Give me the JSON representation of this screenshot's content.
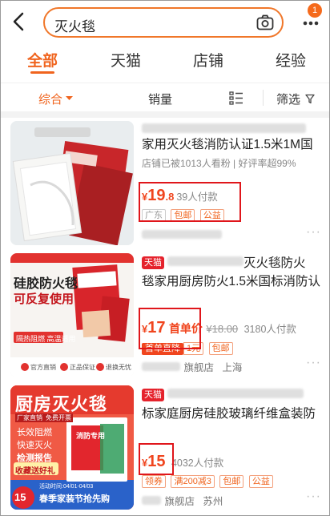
{
  "search": {
    "query": "灭火毯",
    "notification_count": "1"
  },
  "tabs": [
    "全部",
    "天猫",
    "店铺",
    "经验"
  ],
  "filters": {
    "sort": "综合",
    "sales": "销量",
    "filter": "筛选"
  },
  "products": [
    {
      "title_line2": "家用灭火毯消防认证1.5米1M国",
      "sub": "店铺已被1013人看粉 | 好评率超99%",
      "price_int": "19",
      "price_dec": ".8",
      "paid": "39人付款",
      "tags": [
        "广东",
        "包邮",
        "公益"
      ],
      "image_text": []
    },
    {
      "tmall": "天猫",
      "title_line1_tail": "灭火毯防火",
      "title_line2": "毯家用厨房防火1.5米国标消防认",
      "price_int": "17",
      "first_price": "首单价",
      "orig_price": "¥18.00",
      "paid": "3180人付款",
      "badges": [
        "首单直降",
        "1元",
        "包邮"
      ],
      "shop": "旗舰店",
      "location": "上海",
      "image_text": [
        "硅胶防火毯",
        "可反复使用",
        "隔热阻燃 高温适用",
        "官方直销",
        "正品保证",
        "退换无忧"
      ]
    },
    {
      "tmall": "天猫",
      "title_line2": "标家庭厨房硅胶玻璃纤维盒装防",
      "price_int": "15",
      "paid": "4032人付款",
      "badges": [
        "领券",
        "满200减3",
        "包邮",
        "公益"
      ],
      "shop": "旗舰店",
      "location": "苏州",
      "image_text": [
        "厨房灭火毯",
        "厂家直销",
        "免费开票",
        "长效阻燃",
        "快速灭火",
        "检测报告",
        "收藏送",
        "好礼",
        "活动时间:04/01-04/03",
        "春季家装节抢先购",
        "15",
        "消防专用"
      ]
    }
  ],
  "colors": {
    "accent": "#f0641e",
    "price": "#f0451e",
    "highlight_box": "#e0161b"
  }
}
